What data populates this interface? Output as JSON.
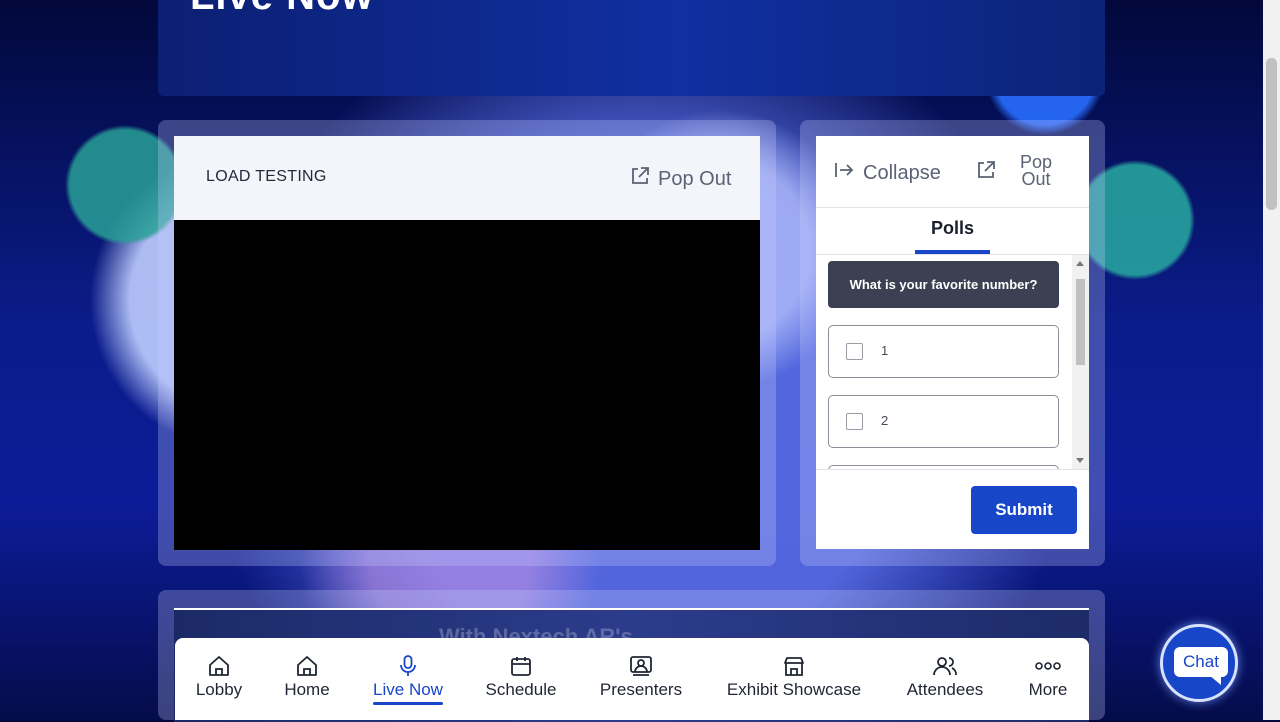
{
  "hero": {
    "title": "Live Now"
  },
  "video": {
    "title": "LOAD TESTING",
    "popout_label": "Pop Out"
  },
  "side": {
    "collapse_label": "Collapse",
    "popout_line1": "Pop",
    "popout_line2": "Out",
    "tab_label": "Polls",
    "question": "What is your favorite number?",
    "options": [
      "1",
      "2"
    ],
    "submit_label": "Submit"
  },
  "lower": {
    "partial_text": "With Nextech AR's"
  },
  "nav": {
    "items": [
      {
        "label": "Lobby",
        "icon": "home-icon"
      },
      {
        "label": "Home",
        "icon": "home-icon"
      },
      {
        "label": "Live Now",
        "icon": "microphone-icon"
      },
      {
        "label": "Schedule",
        "icon": "calendar-icon"
      },
      {
        "label": "Presenters",
        "icon": "presenter-icon"
      },
      {
        "label": "Exhibit Showcase",
        "icon": "store-icon"
      },
      {
        "label": "Attendees",
        "icon": "people-icon"
      },
      {
        "label": "More",
        "icon": "more-dots-icon"
      }
    ],
    "active": "Live Now"
  },
  "chat": {
    "label": "Chat"
  },
  "colors": {
    "accent": "#1746c8",
    "question_bg": "#3b4153",
    "video_bg": "#000000"
  }
}
